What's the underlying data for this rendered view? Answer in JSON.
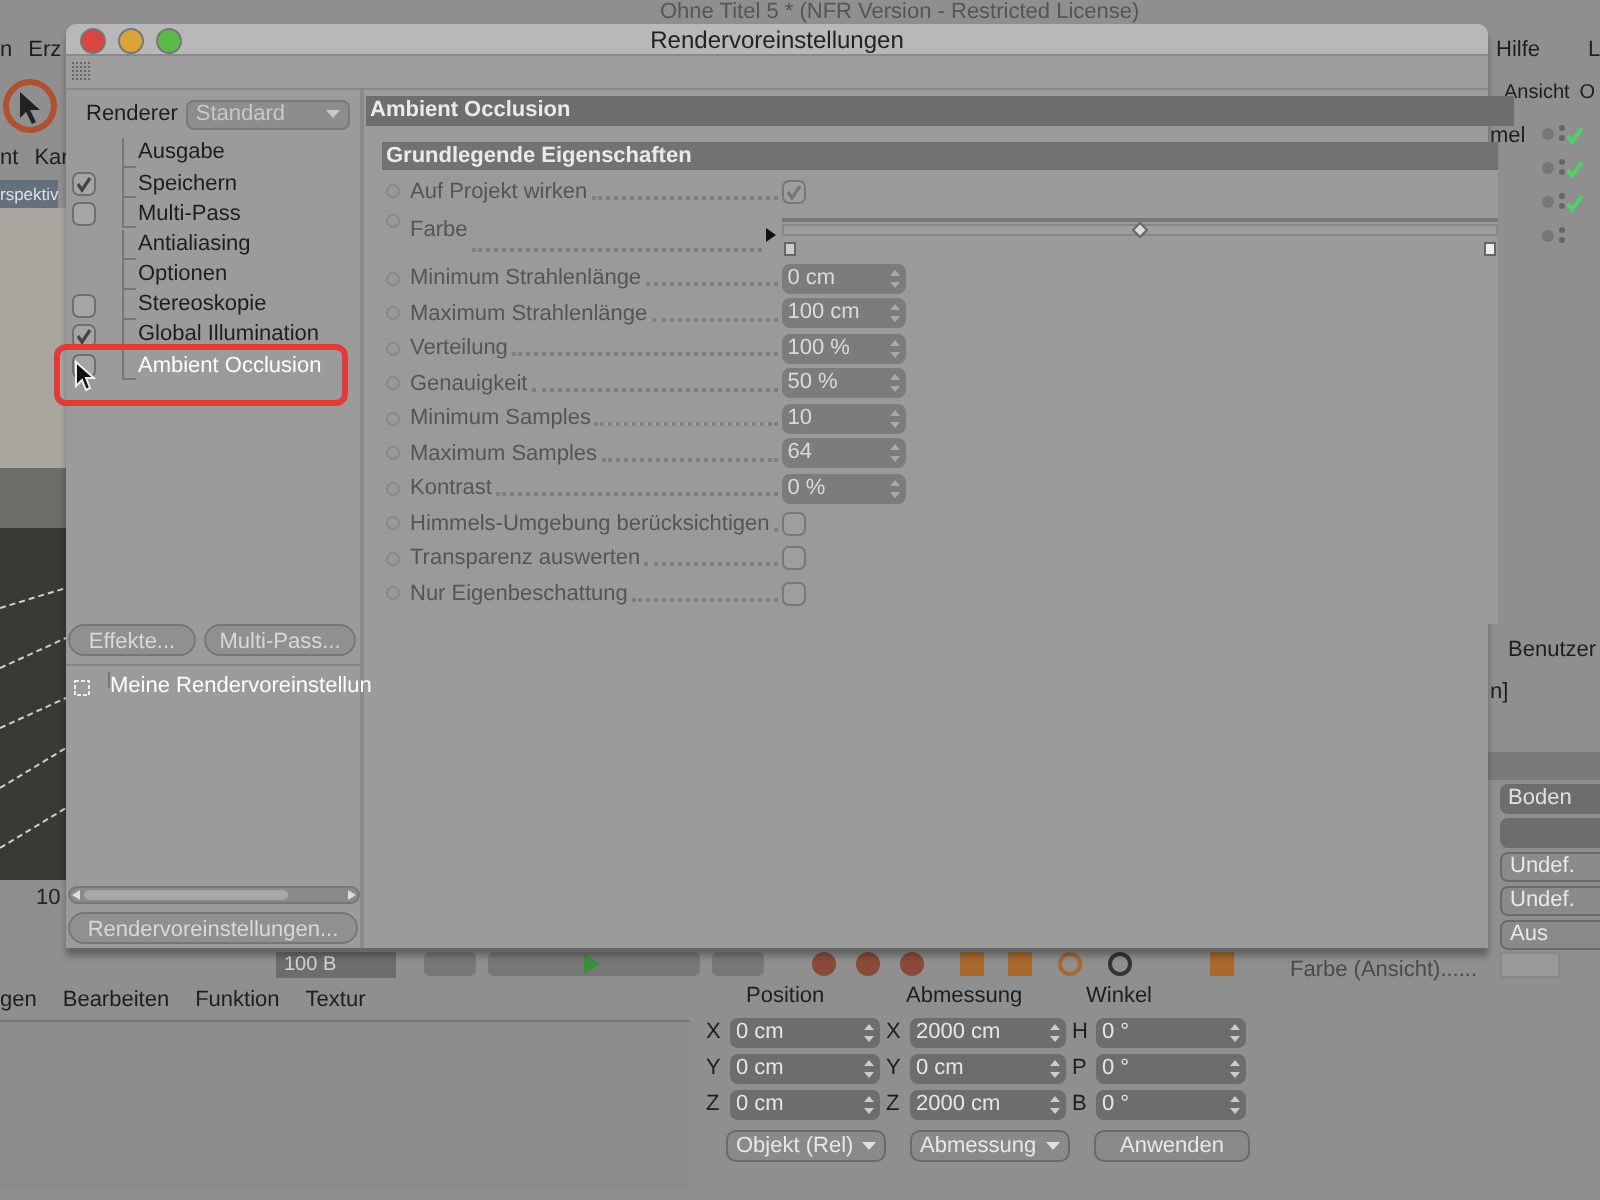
{
  "background_app": {
    "title": "Ohne Titel 5 * (NFR Version - Restricted License)",
    "menu_left": [
      "n",
      "Erz"
    ],
    "menu_right": [
      "Hilfe",
      "L"
    ],
    "toolbar_left": [
      "nt",
      "Kar"
    ],
    "toolbar_right": [
      "Ansicht",
      "O"
    ],
    "viewport_label": "rspektiv",
    "ruler_label": "10",
    "frame_field": "100 B",
    "object_panel": {
      "label": "mel",
      "layers": [
        {
          "checked": true
        },
        {
          "checked": true
        },
        {
          "checked": true
        },
        {
          "checked": false
        }
      ]
    },
    "attributes": {
      "tab": "Benutzer",
      "title": "n]",
      "fields": [
        {
          "kind": "dropdown",
          "value": "Boden"
        },
        {
          "kind": "blank"
        },
        {
          "kind": "button",
          "value": "Undef."
        },
        {
          "kind": "button",
          "value": "Undef."
        },
        {
          "kind": "button",
          "value": "Aus"
        }
      ],
      "color_label": "Farbe (Ansicht)......"
    },
    "material_menu": [
      "gen",
      "Bearbeiten",
      "Funktion",
      "Textur"
    ],
    "coordinates": {
      "headers": [
        "Position",
        "Abmessung",
        "Winkel"
      ],
      "rows": [
        {
          "axis": "X",
          "position": "0 cm",
          "size_axis": "X",
          "size": "2000 cm",
          "angle_axis": "H",
          "angle": "0 °"
        },
        {
          "axis": "Y",
          "position": "0 cm",
          "size_axis": "Y",
          "size": "0 cm",
          "angle_axis": "P",
          "angle": "0 °"
        },
        {
          "axis": "Z",
          "position": "0 cm",
          "size_axis": "Z",
          "size": "2000 cm",
          "angle_axis": "B",
          "angle": "0 °"
        }
      ],
      "buttons": [
        {
          "kind": "dropdown",
          "label": "Objekt (Rel)"
        },
        {
          "kind": "dropdown",
          "label": "Abmessung"
        },
        {
          "kind": "button",
          "label": "Anwenden"
        }
      ]
    }
  },
  "dialog": {
    "title": "Rendervoreinstellungen",
    "renderer_label": "Renderer",
    "renderer_value": "Standard",
    "effects": [
      {
        "label": "Ausgabe",
        "kind": "plain",
        "selected": false
      },
      {
        "label": "Speichern",
        "kind": "toggle",
        "checked": true,
        "selected": false
      },
      {
        "label": "Multi-Pass",
        "kind": "toggle",
        "checked": false,
        "selected": false
      },
      {
        "label": "Antialiasing",
        "kind": "plain",
        "selected": false
      },
      {
        "label": "Optionen",
        "kind": "plain",
        "selected": false
      },
      {
        "label": "Stereoskopie",
        "kind": "toggle",
        "checked": false,
        "selected": false
      },
      {
        "label": "Global Illumination",
        "kind": "toggle",
        "checked": true,
        "selected": false
      },
      {
        "label": "Ambient Occlusion",
        "kind": "toggle",
        "checked": false,
        "selected": true
      }
    ],
    "buttons": [
      "Effekte...",
      "Multi-Pass..."
    ],
    "presets": [
      {
        "label": "Meine Rendervoreinstellun"
      }
    ],
    "bottom_button": "Rendervoreinstellungen...",
    "panel_title": "Ambient Occlusion",
    "section_title": "Grundlegende Eigenschaften",
    "params": [
      {
        "label": "Auf Projekt wirken",
        "kind": "checkbox",
        "checked": true
      },
      {
        "label": "Farbe",
        "kind": "gradient",
        "level": 0.5
      },
      {
        "label": "Minimum Strahlenlänge",
        "kind": "number",
        "value": "0 cm"
      },
      {
        "label": "Maximum Strahlenlänge",
        "kind": "number",
        "value": "100 cm"
      },
      {
        "label": "Verteilung",
        "kind": "number",
        "value": "100 %"
      },
      {
        "label": "Genauigkeit",
        "kind": "number",
        "value": "50 %"
      },
      {
        "label": "Minimum Samples",
        "kind": "number",
        "value": "10"
      },
      {
        "label": "Maximum Samples",
        "kind": "number",
        "value": "64"
      },
      {
        "label": "Kontrast",
        "kind": "number",
        "value": "0 %"
      },
      {
        "label": "Himmels-Umgebung berücksichtigen",
        "kind": "checkbox",
        "checked": false
      },
      {
        "label": "Transparenz auswerten",
        "kind": "checkbox",
        "checked": false
      },
      {
        "label": "Nur Eigenbeschattung",
        "kind": "checkbox",
        "checked": false
      }
    ]
  }
}
